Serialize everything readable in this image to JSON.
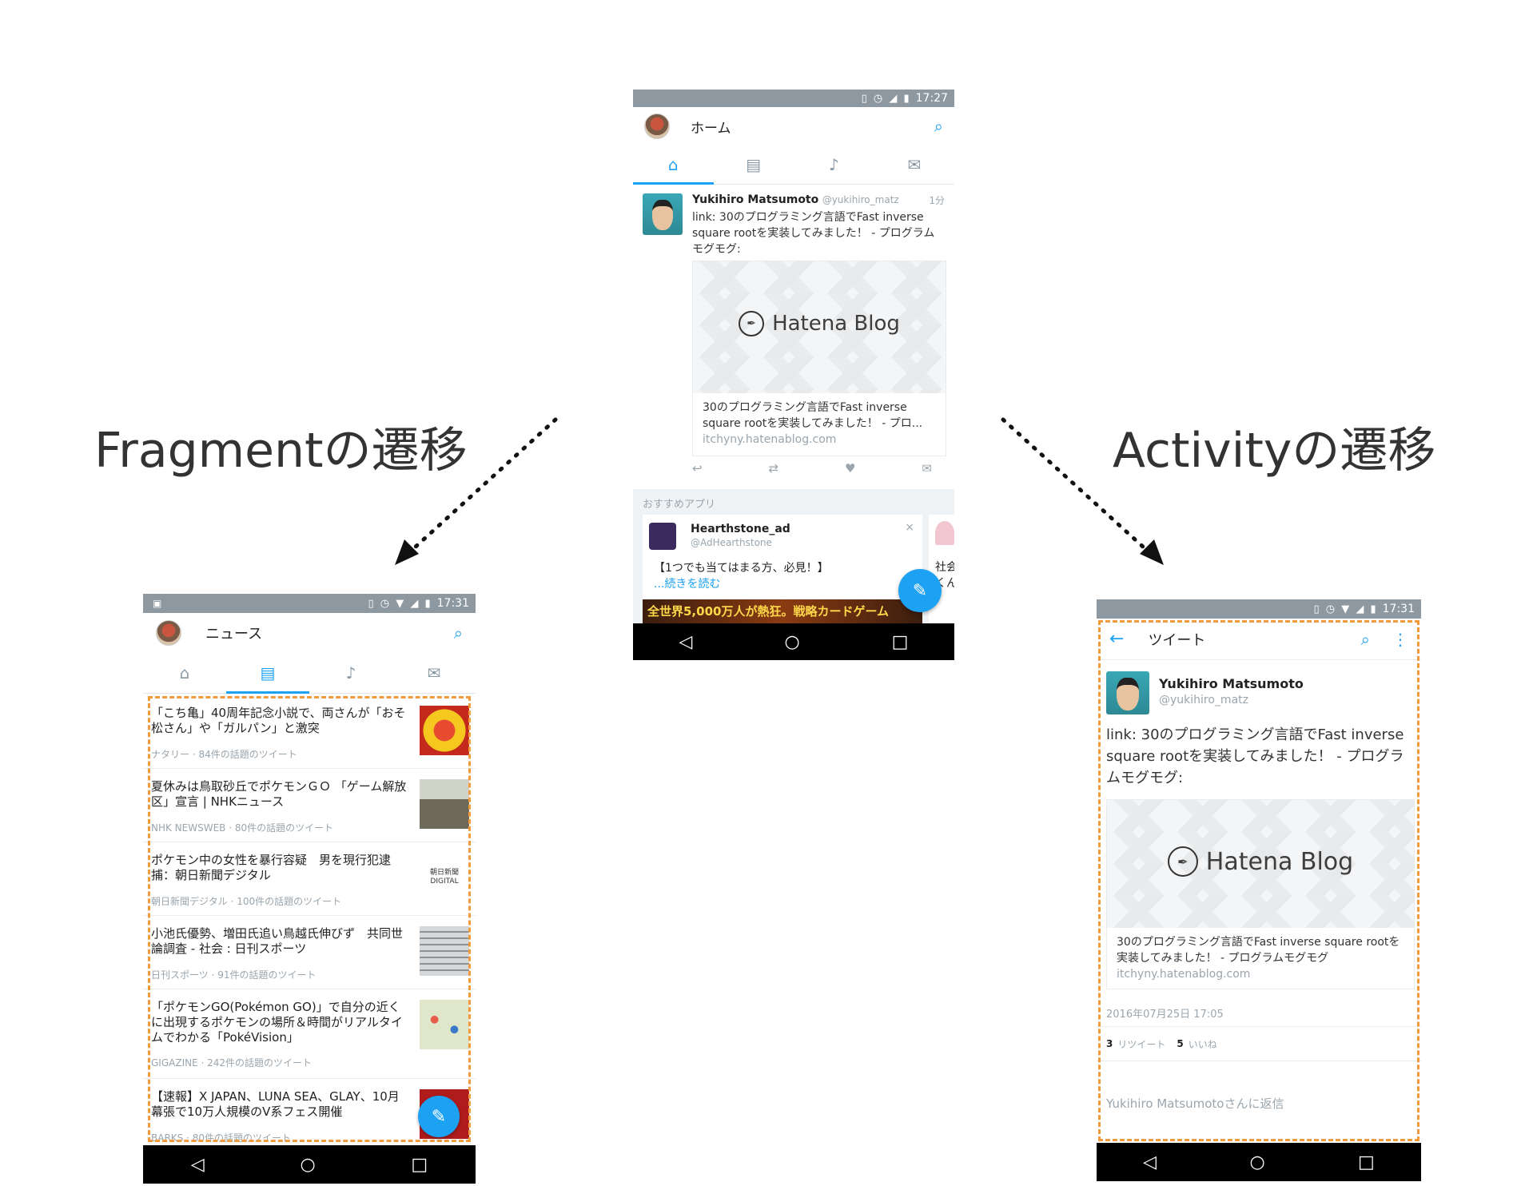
{
  "labels": {
    "fragment": "Fragmentの遷移",
    "activity": "Activityの遷移"
  },
  "colors": {
    "accent": "#1da1f2",
    "dashed_highlight": "#f39a3c",
    "status_bar": "#8d98a1"
  },
  "center_phone": {
    "status_time": "17:27",
    "title": "ホーム",
    "tabs": [
      "home-icon",
      "news-icon",
      "bell-icon",
      "mail-icon"
    ],
    "tweet": {
      "name": "Yukihiro Matsumoto",
      "handle": "@yukihiro_matz",
      "time": "1分",
      "text": "link: 30のプログラミング言語でFast inverse square rootを実装してみました！ - プログラムモグモグ:",
      "card_logo": "Hatena Blog",
      "card_title": "30のプログラミング言語でFast inverse square rootを実装してみました！ - プロ...",
      "card_domain": "itchyny.hatenablog.com"
    },
    "recommend": {
      "header": "おすすめアプリ",
      "name": "Hearthstone_ad",
      "handle": "@AdHearthstone",
      "text": "【1つでも当てはまる方、必見！】",
      "more": "...続きを読む",
      "banner": "全世界5,000万人が熱狂。戦略カードゲーム",
      "side_text": "社会 くん"
    }
  },
  "left_phone": {
    "status_time": "17:31",
    "title": "ニュース",
    "news": [
      {
        "title": "「こち亀」40周年記念小説で、両さんが「おそ松さん」や「ガルパン」と激突",
        "meta": "ナタリー · 84件の話題のツイート"
      },
      {
        "title": "夏休みは鳥取砂丘でポケモンＧＯ 「ゲーム解放区」宣言 | NHKニュース",
        "meta": "NHK NEWSWEB · 80件の話題のツイート"
      },
      {
        "title": "ポケモン中の女性を暴行容疑　男を現行犯逮捕：朝日新聞デジタル",
        "meta": "朝日新聞デジタル · 100件の話題のツイート"
      },
      {
        "title": "小池氏優勢、増田氏追い鳥越氏伸びず　共同世論調査 - 社会 : 日刊スポーツ",
        "meta": "日刊スポーツ · 91件の話題のツイート"
      },
      {
        "title": "「ポケモンGO(Pokémon GO)」で自分の近くに出現するポケモンの場所＆時間がリアルタイムでわかる「PokéVision」",
        "meta": "GIGAZINE · 242件の話題のツイート"
      },
      {
        "title": "【速報】X JAPAN、LUNA SEA、GLAY、10月幕張で10万人規模のV系フェス開催",
        "meta": "BARKS · 80件の話題のツイート"
      }
    ],
    "asahi_logo": "朝日新聞 DIGITAL"
  },
  "right_phone": {
    "status_time": "17:31",
    "title": "ツイート",
    "name": "Yukihiro Matsumoto",
    "handle": "@yukihiro_matz",
    "text": "link: 30のプログラミング言語でFast inverse square rootを実装してみました！ - プログラムモグモグ:",
    "card_logo": "Hatena Blog",
    "card_title": "30のプログラミング言語でFast inverse square rootを実装してみました！ - プログラムモグモグ",
    "card_domain": "itchyny.hatenablog.com",
    "date": "2016年07月25日 17:05",
    "retweet_count": "3",
    "retweet_label": "リツイート",
    "like_count": "5",
    "like_label": "いいね",
    "reply_placeholder": "Yukihiro Matsumotoさんに返信"
  }
}
